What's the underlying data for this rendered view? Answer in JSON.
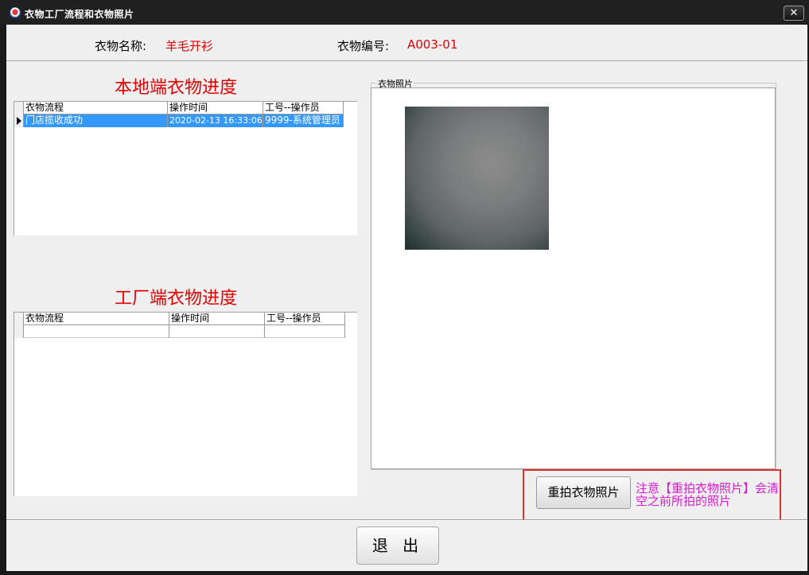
{
  "window": {
    "title": "衣物工厂流程和衣物照片",
    "close_glyph": "✕"
  },
  "header": {
    "name_label": "衣物名称:",
    "name_value": "羊毛开衫",
    "code_label": "衣物编号:",
    "code_value": "A003-01"
  },
  "local": {
    "title": "本地端衣物进度",
    "columns": [
      "衣物流程",
      "操作时间",
      "工号--操作员"
    ],
    "rows": [
      {
        "process": "门店揽收成功",
        "time": "2020-02-13 16:33:06",
        "operator": "9999-系统管理员",
        "selected": true
      }
    ]
  },
  "factory": {
    "title": "工厂端衣物进度",
    "columns": [
      "衣物流程",
      "操作时间",
      "工号--操作员"
    ],
    "rows": [
      {
        "process": "",
        "time": "",
        "operator": ""
      }
    ]
  },
  "photo": {
    "group_label": "衣物照片"
  },
  "actions": {
    "retake_label": "重拍衣物照片",
    "notice": "注意【重拍衣物照片】会清空之前所拍的照片",
    "exit_label": "退 出"
  },
  "colors": {
    "value_red": "#e00000",
    "notice_magenta": "#d81bd0",
    "selection_blue": "#3399ff",
    "highlight_box_red": "#e03030"
  },
  "icons": {
    "app": "app-logo-icon",
    "close": "close-icon",
    "row_pointer": "row-pointer-icon"
  }
}
